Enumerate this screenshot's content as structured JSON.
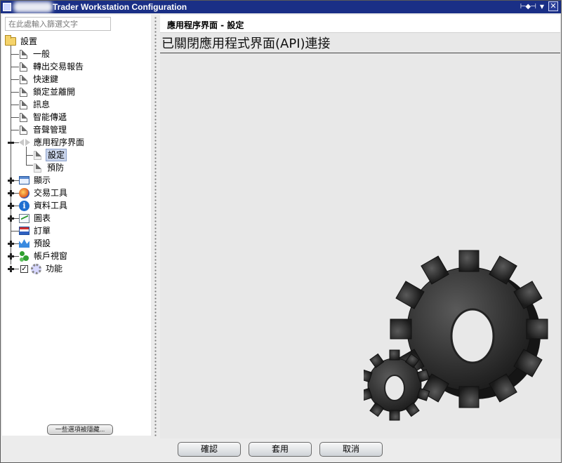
{
  "window": {
    "title": "Trader Workstation Configuration",
    "controls": {
      "pin": "⊢◆⊣",
      "arrow": "▼",
      "close": "✕"
    }
  },
  "search": {
    "placeholder": "在此處輸入篩選文字"
  },
  "tree": {
    "root": "設置",
    "items": [
      {
        "label": "一般"
      },
      {
        "label": "轉出交易報告"
      },
      {
        "label": "快速鍵"
      },
      {
        "label": "鎖定並離開"
      },
      {
        "label": "訊息"
      },
      {
        "label": "智能傳遞"
      },
      {
        "label": "音聲管理"
      },
      {
        "label": "應用程序界面",
        "children": [
          {
            "label": "設定",
            "selected": true
          },
          {
            "label": "預防"
          }
        ]
      },
      {
        "label": "顯示"
      },
      {
        "label": "交易工具"
      },
      {
        "label": "資料工具"
      },
      {
        "label": "圖表"
      },
      {
        "label": "訂單"
      },
      {
        "label": "預設"
      },
      {
        "label": "帳戶視窗"
      },
      {
        "label": "功能"
      }
    ]
  },
  "left_footer": {
    "more_button_label": "一些選項被隱藏..."
  },
  "panel": {
    "header": "應用程序界面 - 設定",
    "status": "已關閉應用程式界面(API)連接"
  },
  "buttons": {
    "ok": "確認",
    "apply": "套用",
    "cancel": "取消"
  },
  "colors": {
    "titlebar": "#1a2f86",
    "selection": "#c9d4ea",
    "panel_bg": "#e8e8e8"
  }
}
